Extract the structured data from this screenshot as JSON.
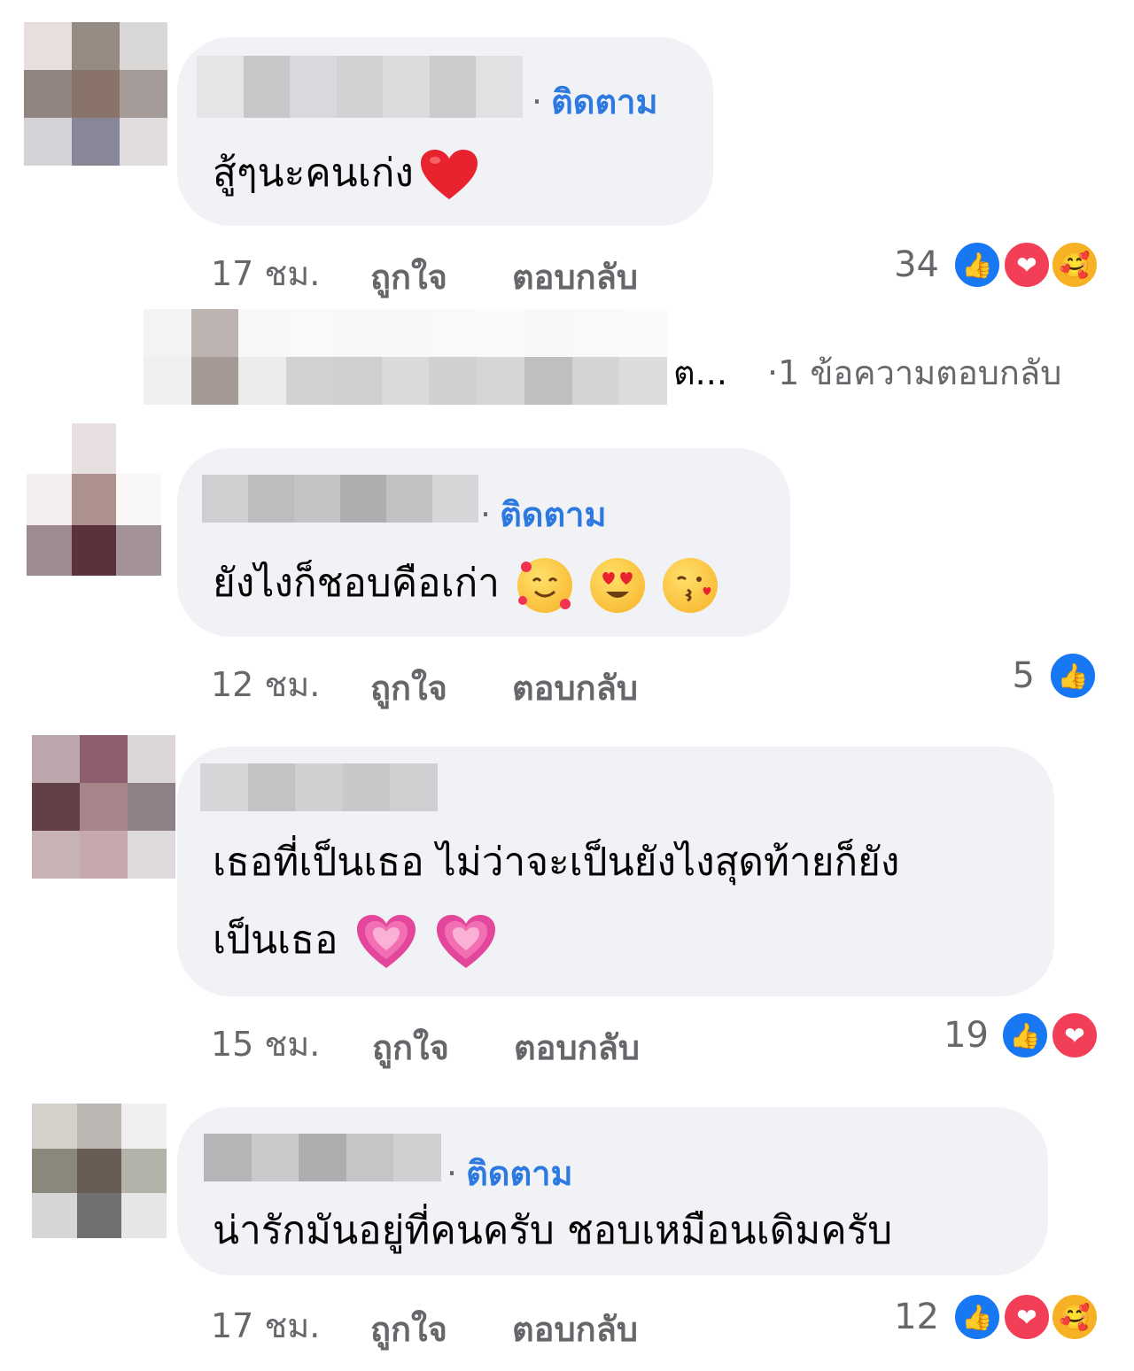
{
  "comments": [
    {
      "follow": "ติดตาม",
      "text": "สู้ๆนะคนเก่ง",
      "emojis": [
        "red-heart"
      ],
      "time": "17 ชม.",
      "like": "ถูกใจ",
      "reply": "ตอบกลับ",
      "reaction_count": "34",
      "reactions": [
        "like",
        "love",
        "care"
      ]
    },
    {
      "follow": "ติดตาม",
      "text": "ยังไงก็ชอบคือเก่า",
      "emojis": [
        "smiling-face-with-hearts",
        "heart-eyes",
        "kissing-face"
      ],
      "time": "12 ชม.",
      "like": "ถูกใจ",
      "reply": "ตอบกลับ",
      "reaction_count": "5",
      "reactions": [
        "like"
      ]
    },
    {
      "follow": "",
      "text_line1": "เธอที่เป็นเธอ ไม่ว่าจะเป็นยังไงสุดท้ายก็ยัง",
      "text_line2": "เป็นเธอ",
      "emojis": [
        "growing-heart",
        "growing-heart"
      ],
      "time": "15 ชม.",
      "like": "ถูกใจ",
      "reply": "ตอบกลับ",
      "reaction_count": "19",
      "reactions": [
        "like",
        "love"
      ]
    },
    {
      "follow": "ติดตาม",
      "text": "น่ารักมันอยู่ที่คนครับ ชอบเหมือนเดิมครับ",
      "time": "17 ชม.",
      "like": "ถูกใจ",
      "reply": "ตอบกลับ",
      "reaction_count": "12",
      "reactions": [
        "like",
        "love",
        "care"
      ]
    }
  ],
  "reply_thread": {
    "trailing": "ต...",
    "count_label": "1 ข้อความตอบกลับ"
  },
  "colors": {
    "bubble": "#f0f2f5",
    "link": "#2d79e0",
    "meta": "#65676b",
    "like": "#1877f2",
    "love": "#f33e58",
    "care": "#f7b125"
  }
}
